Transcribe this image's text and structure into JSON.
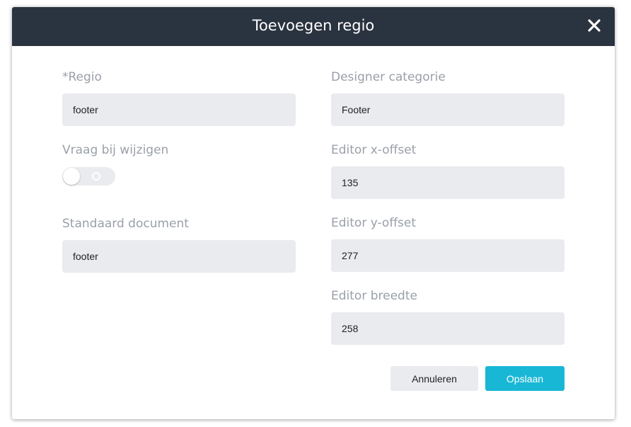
{
  "dialog": {
    "title": "Toevoegen regio",
    "close_icon": "close-icon"
  },
  "form": {
    "regio": {
      "required_mark": "*",
      "label": "Regio",
      "value": "footer"
    },
    "designer_categorie": {
      "label": "Designer categorie",
      "value": "Footer"
    },
    "vraag_bij_wijzigen": {
      "label": "Vraag bij wijzigen",
      "enabled": false
    },
    "editor_x_offset": {
      "label": "Editor x-offset",
      "value": "135"
    },
    "standaard_document": {
      "label": "Standaard document",
      "value": "footer"
    },
    "editor_y_offset": {
      "label": "Editor y-offset",
      "value": "277"
    },
    "editor_breedte": {
      "label": "Editor breedte",
      "value": "258"
    }
  },
  "buttons": {
    "cancel_label": "Annuleren",
    "save_label": "Opslaan"
  },
  "colors": {
    "header_bg": "#2a3340",
    "field_bg": "#e9ebee",
    "label_text": "#9aa0a8",
    "primary": "#19b7d6"
  }
}
